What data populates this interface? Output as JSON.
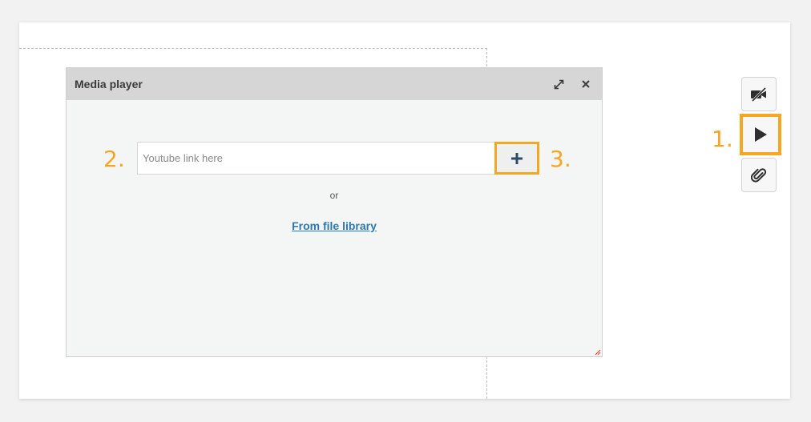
{
  "modal": {
    "title": "Media player",
    "expand_icon": "expand-arrows-icon",
    "close_icon": "close-icon",
    "url_placeholder": "Youtube link here",
    "add_icon": "plus-icon",
    "or_text": "or",
    "library_link": "From file library"
  },
  "steps": {
    "one": "1.",
    "two": "2.",
    "three": "3."
  },
  "toolbar": {
    "items": [
      {
        "icon": "video-off-icon"
      },
      {
        "icon": "play-icon"
      },
      {
        "icon": "paperclip-icon"
      }
    ]
  },
  "colors": {
    "highlight": "#f5a623",
    "header_bg": "#d6d6d6",
    "link": "#2a78b0",
    "icon_dark": "#2f2f2f"
  }
}
